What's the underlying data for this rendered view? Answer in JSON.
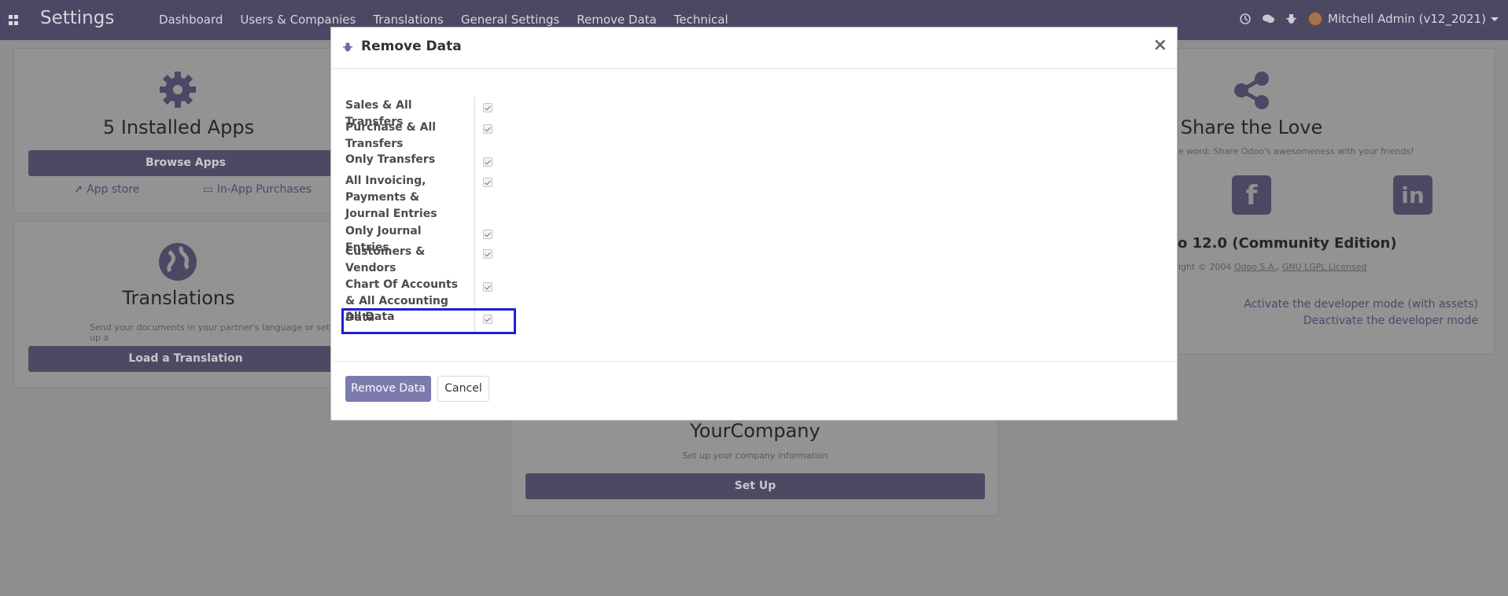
{
  "app": {
    "title": "Settings"
  },
  "menu": [
    "Dashboard",
    "Users & Companies",
    "Translations",
    "General Settings",
    "Remove Data",
    "Technical"
  ],
  "user": {
    "name": "Mitchell Admin (v12_2021)"
  },
  "background": {
    "apps_title": "5 Installed Apps",
    "browse_apps": "Browse Apps",
    "app_store": "App store",
    "in_app": "In-App Purchases",
    "translations_title": "Translations",
    "translations_desc": "Send your documents in your partner's language or set up a",
    "load_translation": "Load a Translation",
    "share_title": "Share the Love",
    "share_desc": "e word: Share Odoo's awesomeness with your friends!",
    "edition": "o 12.0 (Community Edition)",
    "copyright": "ight © 2004",
    "odoo_sa": "Odoo S.A.",
    "gnu": "GNU LGPL Licensed",
    "dev_assets": "Activate the developer mode (with assets)",
    "dev_deactivate": "Deactivate the developer mode",
    "company_title": "YourCompany",
    "company_desc": "Set up your company information",
    "set_up": "Set Up"
  },
  "modal": {
    "title": "Remove Data",
    "fields": [
      {
        "label": "Sales & All Transfers",
        "checked": true
      },
      {
        "label": "Purchase & All Transfers",
        "checked": true
      },
      {
        "label": "Only Transfers",
        "checked": true
      },
      {
        "label": "All Invoicing, Payments & Journal Entries",
        "checked": true
      },
      {
        "label": "Only Journal Entries",
        "checked": true
      },
      {
        "label": "Customers & Vendors",
        "checked": true
      },
      {
        "label": "Chart Of Accounts & All Accounting Data",
        "checked": true
      },
      {
        "label": "All Data",
        "checked": true
      }
    ],
    "primary_button": "Remove Data",
    "cancel_button": "Cancel"
  }
}
